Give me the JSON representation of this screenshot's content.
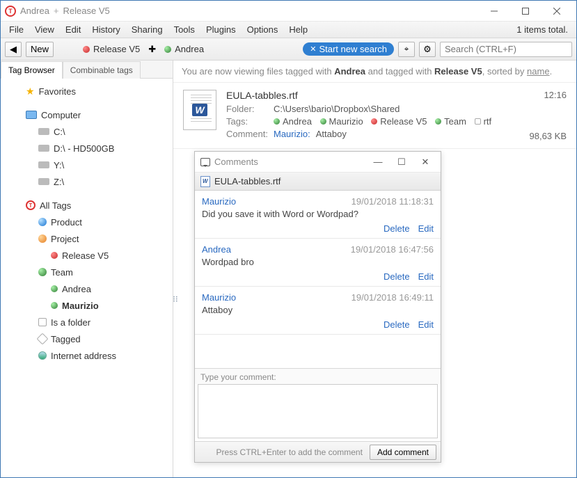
{
  "window": {
    "title_part1": "Andrea",
    "title_sep": "+",
    "title_part2": "Release V5"
  },
  "menu": [
    "File",
    "View",
    "Edit",
    "History",
    "Sharing",
    "Tools",
    "Plugins",
    "Options",
    "Help"
  ],
  "items_total": "1 items total.",
  "toolbar": {
    "back": "◀",
    "new": "New",
    "loc1": "Release V5",
    "loc2": "Andrea",
    "start_search": "Start new search",
    "search_placeholder": "Search (CTRL+F)"
  },
  "sidebar": {
    "tab1": "Tag Browser",
    "tab2": "Combinable tags",
    "favorites": "Favorites",
    "computer": "Computer",
    "drives": [
      "C:\\",
      "D:\\ - HD500GB",
      "Y:\\",
      "Z:\\"
    ],
    "all_tags": "All Tags",
    "product": "Product",
    "project": "Project",
    "release_v5": "Release V5",
    "team": "Team",
    "andrea": "Andrea",
    "maurizio": "Maurizio",
    "is_folder": "Is a folder",
    "tagged": "Tagged",
    "internet": "Internet address"
  },
  "viewing": {
    "pre": "You are now viewing files tagged with ",
    "t1": "Andrea",
    "mid": "  and  tagged with ",
    "t2": "Release V5",
    "post": ", sorted by ",
    "sort": "name",
    "dot": "."
  },
  "file": {
    "name": "EULA-tabbles.rtf",
    "folder_label": "Folder:",
    "folder": "C:\\Users\\bario\\Dropbox\\Shared",
    "tags_label": "Tags:",
    "tags": [
      {
        "name": "Andrea",
        "color": "green"
      },
      {
        "name": "Maurizio",
        "color": "green"
      },
      {
        "name": "Release V5",
        "color": "red"
      },
      {
        "name": "Team",
        "color": "green"
      },
      {
        "name": "rtf",
        "color": "sq"
      }
    ],
    "comment_label": "Comment:",
    "comment_author": "Maurizio:",
    "comment_text": "Attaboy",
    "time": "12:16",
    "size": "98,63 KB"
  },
  "comments_panel": {
    "title": "Comments",
    "file": "EULA-tabbles.rtf",
    "comments": [
      {
        "author": "Maurizio",
        "time": "19/01/2018 11:18:31",
        "text": "Did you save it with Word or Wordpad?"
      },
      {
        "author": "Andrea",
        "time": "19/01/2018 16:47:56",
        "text": "Wordpad bro"
      },
      {
        "author": "Maurizio",
        "time": "19/01/2018 16:49:11",
        "text": "Attaboy"
      }
    ],
    "delete": "Delete",
    "edit": "Edit",
    "input_label": "Type your comment:",
    "hint": "Press CTRL+Enter to add the comment",
    "add": "Add comment"
  }
}
